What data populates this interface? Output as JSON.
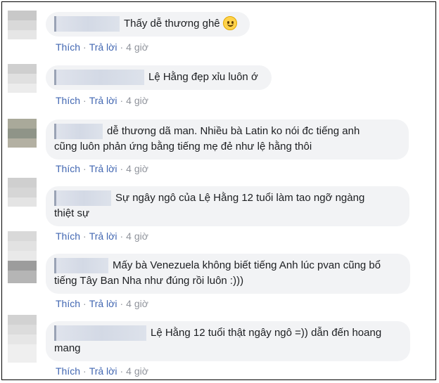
{
  "comments": [
    {
      "text": "Thấy dễ thương ghê",
      "emoji": "slightly-smiling-face",
      "actions": {
        "like": "Thích",
        "reply": "Trả lời",
        "sep": "·",
        "time": "4 giờ"
      }
    },
    {
      "text": "Lệ Hằng đẹp xỉu luôn ớ",
      "actions": {
        "like": "Thích",
        "reply": "Trả lời",
        "sep": "·",
        "time": "4 giờ"
      }
    },
    {
      "text_line1": "dễ thương dã man. Nhiều bà Latin ko nói đc tiếng anh",
      "text_line2": "cũng luôn phản ứng bằng tiếng mẹ đẻ như lệ hằng thôi",
      "actions": {
        "like": "Thích",
        "reply": "Trả lời",
        "sep": "·",
        "time": "4 giờ"
      }
    },
    {
      "text_line1": "Sự ngây ngô của Lệ Hằng 12 tuổi làm tao ngỡ ngàng",
      "text_line2": "thiệt sự",
      "actions": {
        "like": "Thích",
        "reply": "Trả lời",
        "sep": "·",
        "time": "4 giờ"
      }
    },
    {
      "text_line1": "Mấy bà Venezuela không biết tiếng Anh lúc pvan cũng bổ",
      "text_line2": "tiếng Tây Ban Nha như đúng rồi luôn :)))",
      "actions": {
        "like": "Thích",
        "reply": "Trả lời",
        "sep": "·",
        "time": "4 giờ"
      }
    },
    {
      "text_line1": "Lệ Hằng 12 tuổi thật ngây ngô =)) dẫn đến hoang",
      "text_line2": "mang",
      "actions": {
        "like": "Thích",
        "reply": "Trả lời",
        "sep": "·",
        "time": "4 giờ"
      }
    }
  ],
  "colors": {
    "bubble": "#f2f3f5",
    "link": "#4267b2",
    "meta": "#90949c",
    "text": "#1c1e21"
  }
}
